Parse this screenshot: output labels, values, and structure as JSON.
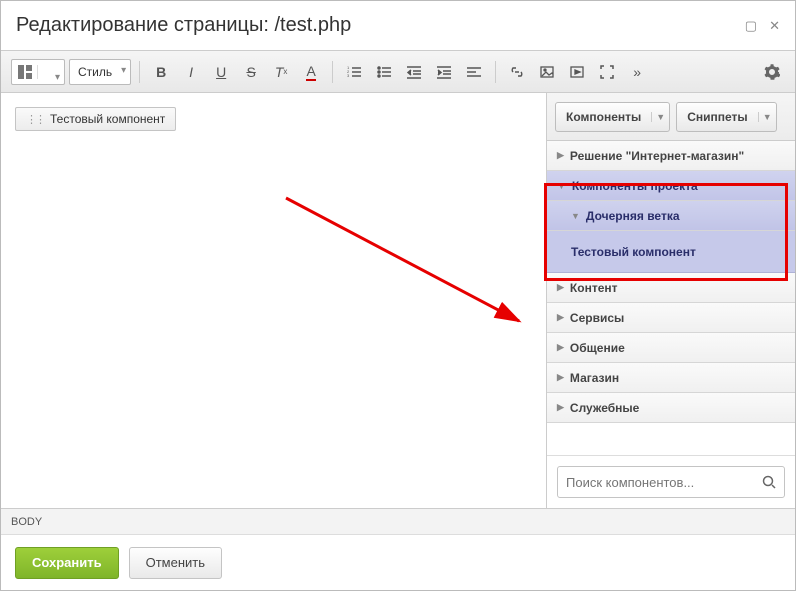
{
  "window": {
    "title": "Редактирование страницы: /test.php"
  },
  "toolbar": {
    "style_select": "Стиль"
  },
  "editor": {
    "chip_label": "Тестовый компонент"
  },
  "sidebar": {
    "tabs": {
      "components": "Компоненты",
      "snippets": "Сниппеты"
    },
    "items": [
      "Решение \"Интернет-магазин\"",
      "Компоненты проекта",
      "Дочерняя ветка",
      "Тестовый компонент",
      "Контент",
      "Сервисы",
      "Общение",
      "Магазин",
      "Служебные"
    ],
    "search_placeholder": "Поиск компонентов..."
  },
  "statusbar": {
    "path": "BODY"
  },
  "footer": {
    "save": "Сохранить",
    "cancel": "Отменить"
  }
}
